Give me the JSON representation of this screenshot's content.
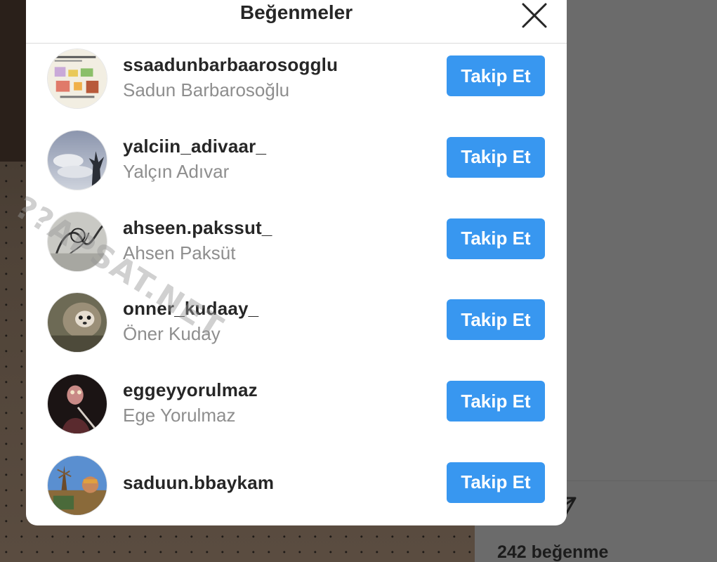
{
  "modal": {
    "title": "Beğenmeler",
    "close_icon": "close-icon",
    "follow_label": "Takip Et",
    "users": [
      {
        "username": "ssaadunbarbaarosogglu",
        "full_name": "Sadun Barbarosoğlu",
        "avatar": "infographic-avatar"
      },
      {
        "username": "yalciin_adivaar_",
        "full_name": "Yalçın Adıvar",
        "avatar": "sky-tree-avatar"
      },
      {
        "username": "ahseen.pakssut_",
        "full_name": "Ahsen Paksüt",
        "avatar": "sketch-avatar"
      },
      {
        "username": "onner_kudaay_",
        "full_name": "Öner Kuday",
        "avatar": "sloth-avatar"
      },
      {
        "username": "eggeyyorulmaz",
        "full_name": "Ege Yorulmaz",
        "avatar": "dark-portrait-avatar"
      },
      {
        "username": "saduun.bbaykam",
        "full_name": "",
        "avatar": "outdoor-avatar"
      }
    ]
  },
  "background": {
    "likes_count": "242 beğenme",
    "icons": [
      "comment-icon",
      "share-icon"
    ]
  },
  "watermark": "??APSAT.NET",
  "colors": {
    "accent": "#3897f0",
    "username": "#262626",
    "fullname": "#8e8e8e"
  }
}
